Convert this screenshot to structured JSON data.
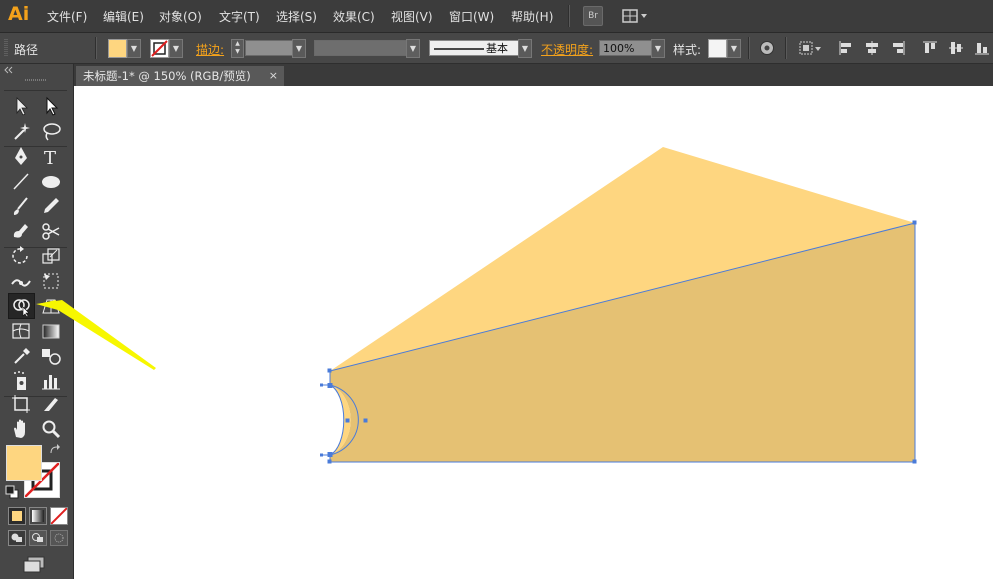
{
  "app": {
    "logo": "Ai"
  },
  "menu": [
    "文件(F)",
    "编辑(E)",
    "对象(O)",
    "文字(T)",
    "选择(S)",
    "效果(C)",
    "视图(V)",
    "窗口(W)",
    "帮助(H)"
  ],
  "menu_right": {
    "bridge_label": "Br"
  },
  "control": {
    "selection_label": "路径",
    "stroke_label": "描边:",
    "stroke_style_label": "基本",
    "opacity_label": "不透明度:",
    "opacity_value": "100%",
    "style_label": "样式:"
  },
  "document": {
    "tab_title": "未标题-1* @ 150% (RGB/预览)",
    "close_symbol": "×"
  },
  "colors": {
    "fill": "#fed680",
    "shape_dark": "#e5c173",
    "selection": "#4a7bd9",
    "arrow": "#f7f700",
    "ui_accent": "#f4a21b"
  },
  "icons": {
    "toolbox_collapse": "collapse-icon",
    "fill_swatch": "fill-swatch-icon",
    "stroke_swatch": "stroke-none-icon"
  }
}
